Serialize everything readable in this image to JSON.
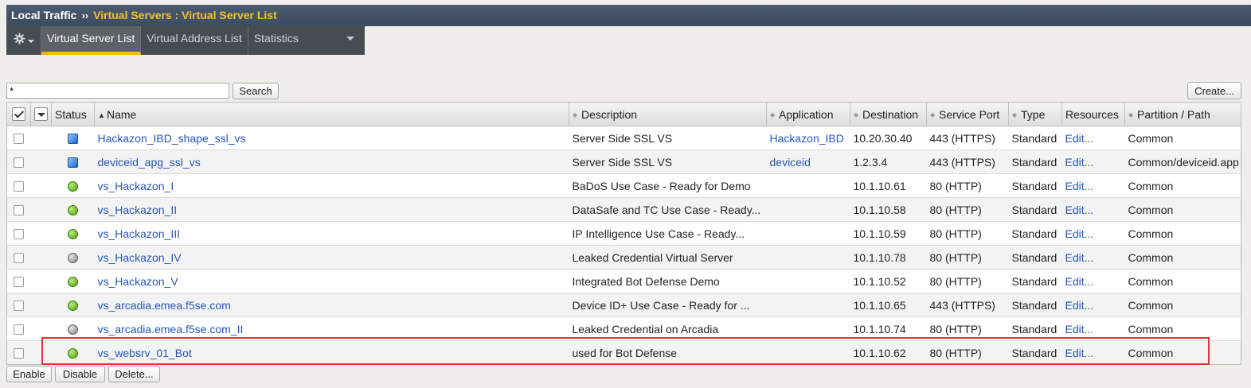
{
  "breadcrumb": {
    "root": "Local Traffic",
    "separator": "››",
    "current": "Virtual Servers : Virtual Server List"
  },
  "tabs": {
    "virtual_server_list": "Virtual Server List",
    "virtual_address_list": "Virtual Address List",
    "statistics": "Statistics"
  },
  "search": {
    "value": "*",
    "button": "Search"
  },
  "create_button": "Create...",
  "table": {
    "headers": {
      "status": "Status",
      "name": "Name",
      "description": "Description",
      "application": "Application",
      "destination": "Destination",
      "service_port": "Service Port",
      "type": "Type",
      "resources": "Resources",
      "partition": "Partition / Path"
    },
    "rows": [
      {
        "status": "blue-square",
        "name": "Hackazon_IBD_shape_ssl_vs",
        "description": "Server Side SSL VS",
        "application": "Hackazon_IBD",
        "destination": "10.20.30.40",
        "service_port": "443 (HTTPS)",
        "type": "Standard",
        "resources": "Edit...",
        "partition": "Common"
      },
      {
        "status": "blue-square",
        "name": "deviceid_apg_ssl_vs",
        "description": "Server Side SSL VS",
        "application": "deviceid",
        "destination": "1.2.3.4",
        "service_port": "443 (HTTPS)",
        "type": "Standard",
        "resources": "Edit...",
        "partition": "Common/deviceid.app"
      },
      {
        "status": "green-circle",
        "name": "vs_Hackazon_I",
        "description": "BaDoS Use Case - Ready for Demo",
        "application": "",
        "destination": "10.1.10.61",
        "service_port": "80 (HTTP)",
        "type": "Standard",
        "resources": "Edit...",
        "partition": "Common"
      },
      {
        "status": "green-circle",
        "name": "vs_Hackazon_II",
        "description": "DataSafe and TC Use Case - Ready...",
        "application": "",
        "destination": "10.1.10.58",
        "service_port": "80 (HTTP)",
        "type": "Standard",
        "resources": "Edit...",
        "partition": "Common"
      },
      {
        "status": "green-circle",
        "name": "vs_Hackazon_III",
        "description": "IP Intelligence Use Case - Ready...",
        "application": "",
        "destination": "10.1.10.59",
        "service_port": "80 (HTTP)",
        "type": "Standard",
        "resources": "Edit...",
        "partition": "Common"
      },
      {
        "status": "gray-circle",
        "name": "vs_Hackazon_IV",
        "description": "Leaked Credential Virtual Server",
        "application": "",
        "destination": "10.1.10.78",
        "service_port": "80 (HTTP)",
        "type": "Standard",
        "resources": "Edit...",
        "partition": "Common"
      },
      {
        "status": "green-circle",
        "name": "vs_Hackazon_V",
        "description": "Integrated Bot Defense Demo",
        "application": "",
        "destination": "10.1.10.52",
        "service_port": "80 (HTTP)",
        "type": "Standard",
        "resources": "Edit...",
        "partition": "Common"
      },
      {
        "status": "green-circle",
        "name": "vs_arcadia.emea.f5se.com",
        "description": "Device ID+ Use Case - Ready for ...",
        "application": "",
        "destination": "10.1.10.65",
        "service_port": "443 (HTTPS)",
        "type": "Standard",
        "resources": "Edit...",
        "partition": "Common"
      },
      {
        "status": "gray-circle",
        "name": "vs_arcadia.emea.f5se.com_II",
        "description": "Leaked Credential on Arcadia",
        "application": "",
        "destination": "10.1.10.74",
        "service_port": "80 (HTTP)",
        "type": "Standard",
        "resources": "Edit...",
        "partition": "Common"
      },
      {
        "status": "green-circle",
        "name": "vs_websrv_01_Bot",
        "description": "used for Bot Defense",
        "application": "",
        "destination": "10.1.10.62",
        "service_port": "80 (HTTP)",
        "type": "Standard",
        "resources": "Edit...",
        "partition": "Common"
      }
    ]
  },
  "footer_buttons": {
    "enable": "Enable",
    "disable": "Disable",
    "delete": "Delete..."
  },
  "colors": {
    "accent_tab": "#f5b80b",
    "breadcrumb_current": "#f5c322",
    "link": "#2455b9",
    "highlight_box": "#e33232"
  }
}
